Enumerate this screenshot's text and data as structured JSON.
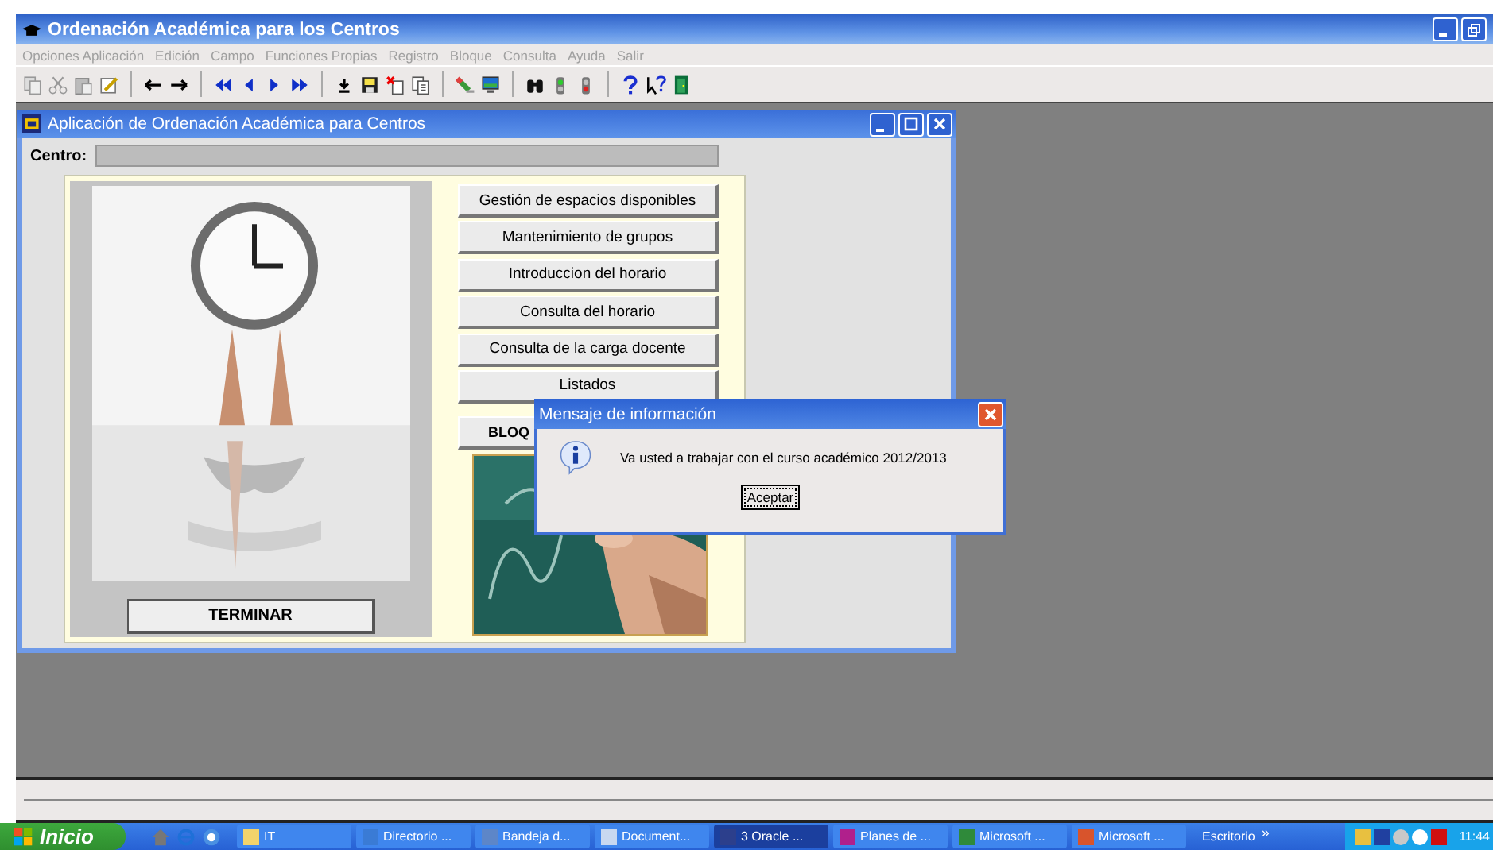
{
  "app_window": {
    "title": "Ordenación Académica para los Centros"
  },
  "menu": [
    {
      "label": "Opciones Aplicación",
      "disabled": true
    },
    {
      "label": "Edición",
      "disabled": true
    },
    {
      "label": "Campo",
      "disabled": true
    },
    {
      "label": "Funciones Propias",
      "disabled": true
    },
    {
      "label": "Registro",
      "disabled": true
    },
    {
      "label": "Bloque",
      "disabled": true
    },
    {
      "label": "Consulta",
      "disabled": true
    },
    {
      "label": "Ayuda",
      "disabled": true
    },
    {
      "label": "Salir",
      "disabled": true
    }
  ],
  "inner_window": {
    "title": "Aplicación de Ordenación Académica para Centros",
    "centro_label": "Centro:",
    "buttons": [
      "Gestión de espacios disponibles",
      "Mantenimiento de grupos",
      "Introduccion del horario",
      "Consulta del horario",
      "Consulta de la carga docente",
      "Listados"
    ],
    "bottom_button": "BLOQ",
    "terminar": "TERMINAR"
  },
  "dialog": {
    "title": "Mensaje de información",
    "message": "Va usted a trabajar con el curso académico 2012/2013",
    "button": "Aceptar"
  },
  "taskbar": {
    "start": "Inicio",
    "tasks": [
      {
        "label": "IT",
        "selected": false
      },
      {
        "label": "Directorio ...",
        "selected": false
      },
      {
        "label": "Bandeja d...",
        "selected": false
      },
      {
        "label": "Document...",
        "selected": false
      },
      {
        "label": "3 Oracle ...",
        "selected": true
      },
      {
        "label": "Planes de ...",
        "selected": false
      },
      {
        "label": "Microsoft ...",
        "selected": false
      },
      {
        "label": "Microsoft ...",
        "selected": false
      }
    ],
    "desktop": "Escritorio",
    "more": "»",
    "clock": "11:44"
  }
}
